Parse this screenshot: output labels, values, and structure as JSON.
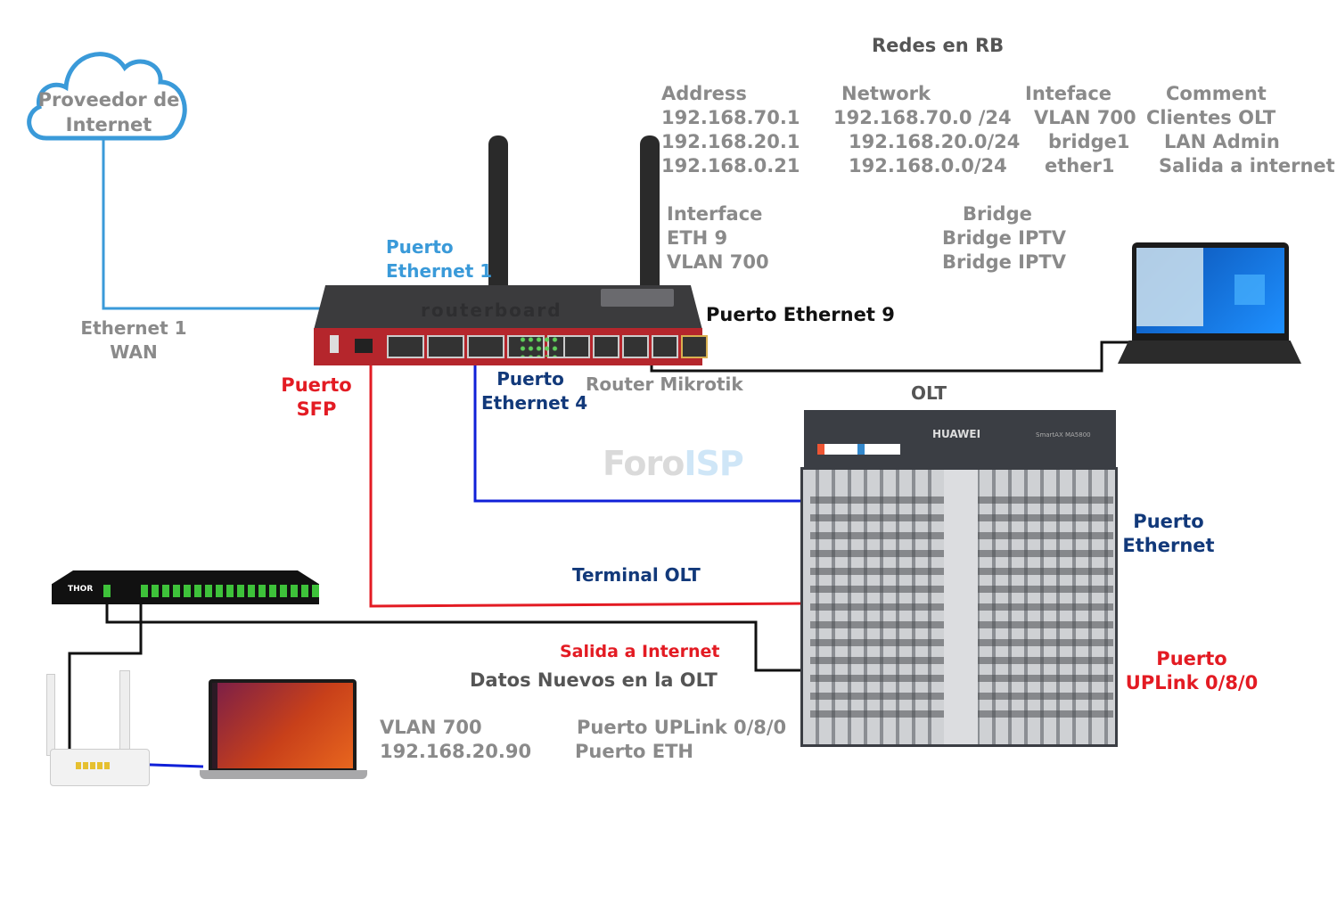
{
  "title": "Redes en RB",
  "rb_networks": {
    "headers": [
      "Address",
      "Network",
      "Inteface",
      "Comment"
    ],
    "rows": [
      [
        "192.168.70.1",
        "192.168.70.0 /24",
        "VLAN 700",
        "Clientes OLT"
      ],
      [
        "192.168.20.1",
        "192.168.20.0/24",
        "bridge1",
        "LAN Admin"
      ],
      [
        "192.168.0.21",
        "192.168.0.0/24",
        "ether1",
        "Salida a internet"
      ]
    ]
  },
  "bridge_ports": {
    "interface_header": "Interface",
    "interfaces": [
      "ETH 9",
      "VLAN 700"
    ],
    "bridge_header": "Bridge",
    "bridges": [
      "Bridge IPTV",
      "Bridge IPTV"
    ]
  },
  "cloud": {
    "line1": "Proveedor de",
    "line2": "Internet"
  },
  "labels": {
    "wan_line1": "Ethernet 1",
    "wan_line2": "WAN",
    "puerto_eth1_line1": "Puerto",
    "puerto_eth1_line2": "Ethernet 1",
    "puerto_eth9": "Puerto Ethernet 9",
    "puerto_sfp_line1": "Puerto",
    "puerto_sfp_line2": "SFP",
    "puerto_eth4_line1": "Puerto",
    "puerto_eth4_line2": "Ethernet 4",
    "router_name": "Router Mikrotik",
    "olt": "OLT",
    "watermark_a": "Foro",
    "watermark_b": "ISP",
    "olt_eth_line1": "Puerto",
    "olt_eth_line2": "Ethernet",
    "terminal_olt": "Terminal OLT",
    "salida_internet": "Salida a Internet",
    "datos_nuevos": "Datos Nuevos en  la OLT",
    "uplink_line1": "Puerto",
    "uplink_line2": "UPLink 0/8/0",
    "client_vlan": "VLAN 700",
    "client_ip": "192.168.20.90",
    "olt_port_uplink": "Puerto UPLink 0/8/0",
    "olt_port_eth": "Puerto ETH"
  },
  "devices": {
    "router_brand": "routerboard",
    "olt_brand": "HUAWEI",
    "olt_model": "SmartAX MA5800",
    "splitter_brand": "THOR"
  },
  "colors": {
    "wan_line": "#3a9ad9",
    "eth4_line": "#1020d8",
    "sfp_line": "#e31b23",
    "eth9_line": "#111111",
    "router_red": "#b5262c",
    "olt_dark": "#3b3e44"
  }
}
